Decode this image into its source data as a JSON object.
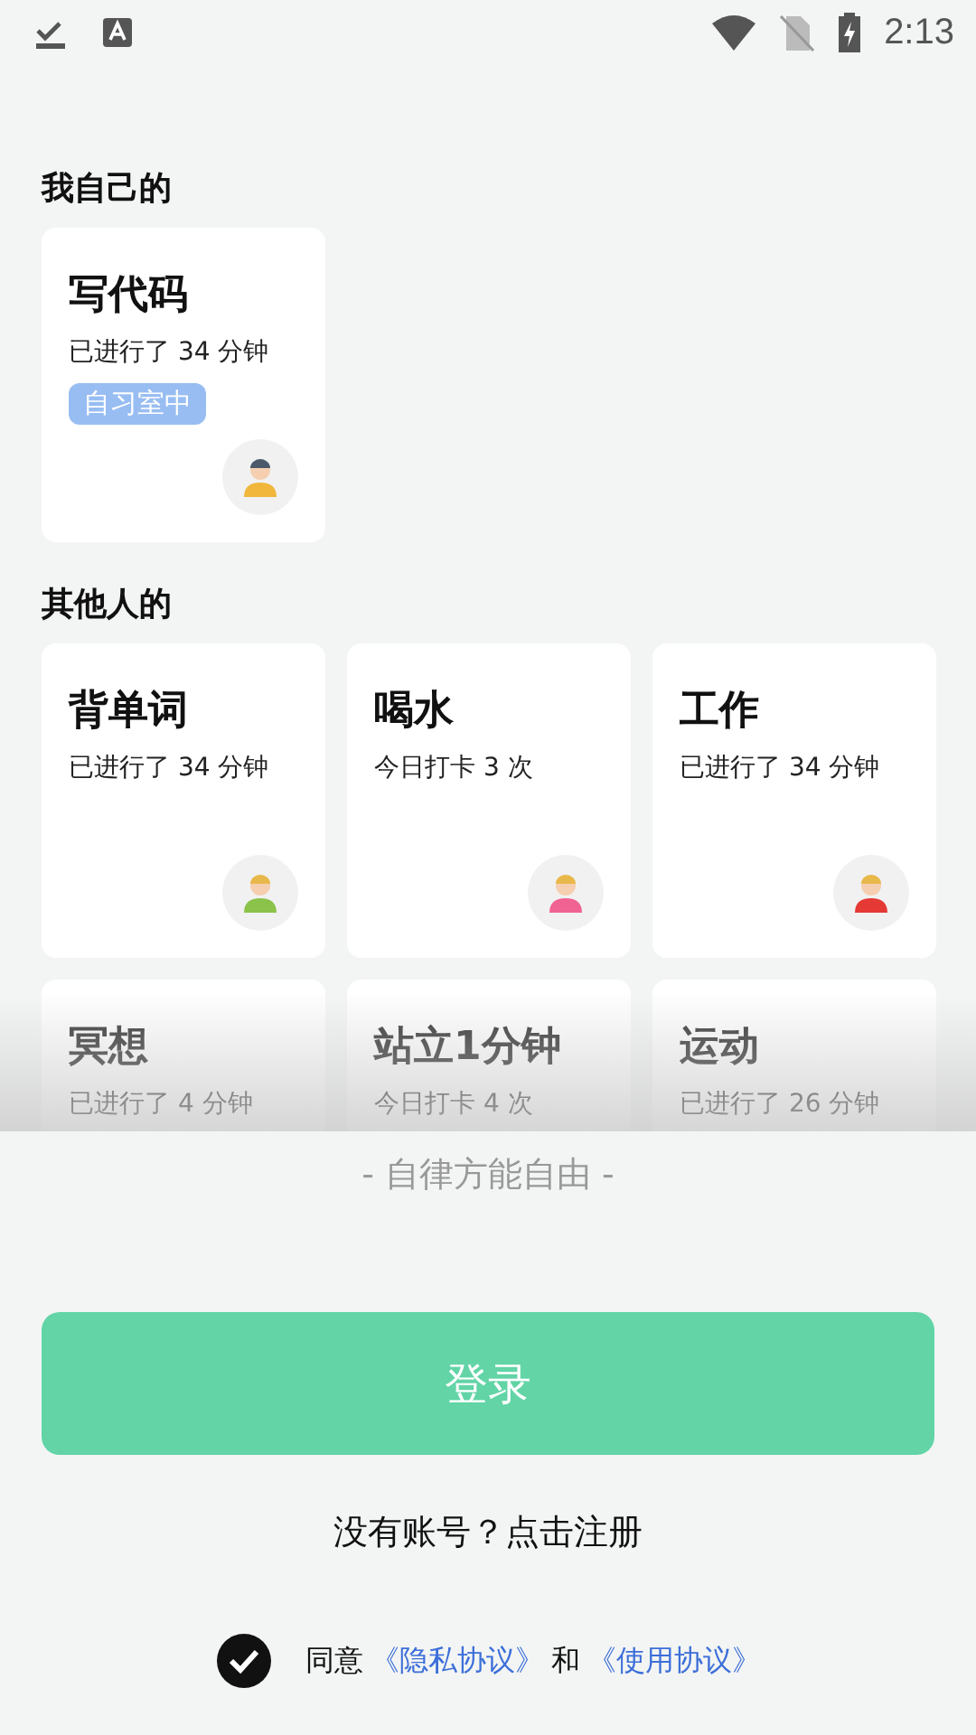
{
  "status_bar": {
    "time": "2:13"
  },
  "mine": {
    "heading": "我自己的",
    "cards": [
      {
        "title": "写代码",
        "subtitle": "已进行了 34 分钟",
        "badge": "自习室中",
        "color": "#f0b73c"
      }
    ]
  },
  "others": {
    "heading": "其他人的",
    "cards": [
      {
        "title": "背单词",
        "subtitle": "已进行了 34 分钟",
        "color": "#8bc34a"
      },
      {
        "title": "喝水",
        "subtitle": "今日打卡 3 次",
        "color": "#f06292"
      },
      {
        "title": "工作",
        "subtitle": "已进行了 34 分钟",
        "color": "#e53935"
      },
      {
        "title": "冥想",
        "subtitle": "已进行了 4 分钟"
      },
      {
        "title": "站立1分钟",
        "subtitle": "今日打卡 4 次"
      },
      {
        "title": "运动",
        "subtitle": "已进行了 26 分钟"
      }
    ]
  },
  "slogan": "- 自律方能自由 -",
  "login_button": "登录",
  "register_link": "没有账号？点击注册",
  "agreement": {
    "checked": true,
    "prefix": "同意",
    "privacy_link": "《隐私协议》",
    "joiner": "和",
    "terms_link": "《使用协议》"
  }
}
